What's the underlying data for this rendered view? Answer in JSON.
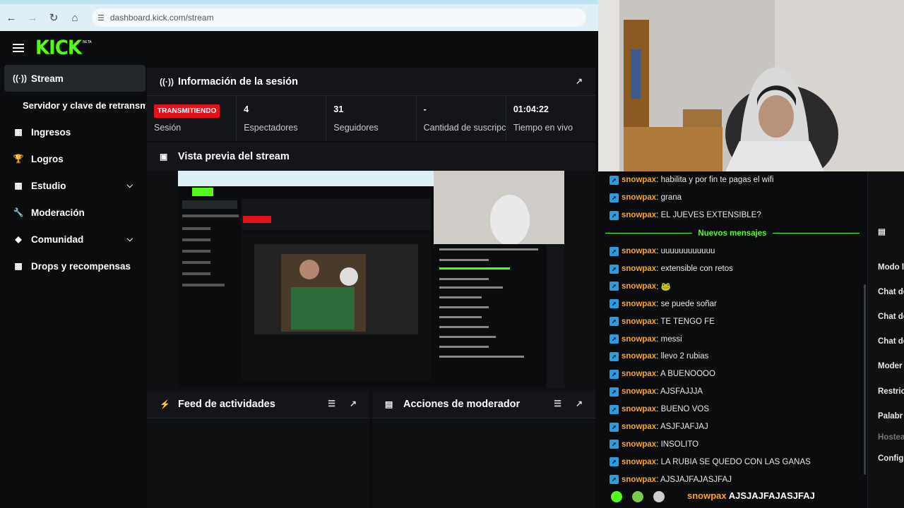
{
  "browser": {
    "url": "dashboard.kick.com/stream"
  },
  "brand": {
    "logo": "KICK",
    "beta": "BETA"
  },
  "sidebar": {
    "items": [
      {
        "label": "Stream",
        "icon": "broadcast-icon"
      },
      {
        "label": "Servidor y clave de retransmisión"
      },
      {
        "label": "Ingresos",
        "icon": "revenue-icon"
      },
      {
        "label": "Logros",
        "icon": "trophy-icon"
      },
      {
        "label": "Estudio",
        "icon": "studio-icon"
      },
      {
        "label": "Moderación",
        "icon": "wrench-icon"
      },
      {
        "label": "Comunidad",
        "icon": "community-icon"
      },
      {
        "label": "Drops y recompensas",
        "icon": "gift-icon"
      }
    ]
  },
  "session": {
    "title": "Información de la sesión",
    "status": "TRANSMITIENDO",
    "status_label": "Sesión",
    "viewers": "4",
    "viewers_label": "Espectadores",
    "followers": "31",
    "followers_label": "Seguidores",
    "subs": "-",
    "subs_label": "Cantidad de suscripciones",
    "uptime": "01:04:22",
    "uptime_label": "Tiempo en vivo"
  },
  "preview": {
    "title": "Vista previa del stream"
  },
  "feed": {
    "title": "Feed de actividades"
  },
  "mod": {
    "title": "Acciones de moderador"
  },
  "chat": {
    "messages_before": [
      {
        "user": "snowpax",
        "text": ": habilita y por fin te pagas el wifi"
      },
      {
        "user": "snowpax",
        "text": ": grana"
      },
      {
        "user": "snowpax",
        "text": ": EL JUEVES EXTENSIBLE?"
      }
    ],
    "new_label": "Nuevos mensajes",
    "messages_after": [
      {
        "user": "snowpax",
        "text": ": uuuuuuuuuuuu"
      },
      {
        "user": "snowpax",
        "text": ": extensible con retos"
      },
      {
        "user": "snowpax",
        "text": ": 🐸"
      },
      {
        "user": "snowpax",
        "text": ": se puede soñar"
      },
      {
        "user": "snowpax",
        "text": ": TE TENGO FE"
      },
      {
        "user": "snowpax",
        "text": ": messi"
      },
      {
        "user": "snowpax",
        "text": ": llevo 2 rubias"
      },
      {
        "user": "snowpax",
        "text": ": A BUENOOOO"
      },
      {
        "user": "snowpax",
        "text": ": AJSFAJJJA"
      },
      {
        "user": "snowpax",
        "text": ": BUENO VOS"
      },
      {
        "user": "snowpax",
        "text": ": ASJFJAFJAJ"
      },
      {
        "user": "snowpax",
        "text": ": INSOLITO"
      },
      {
        "user": "snowpax",
        "text": ": LA RUBIA SE QUEDO CON LAS GANAS"
      },
      {
        "user": "snowpax",
        "text": ": AJSJAJFAJASJFAJ"
      }
    ],
    "overlay_user": "snowpax",
    "overlay_text": " AJSJAJFAJASJFAJ"
  },
  "right_panel": {
    "items": [
      "Modo l",
      "Chat de",
      "Chat de",
      "Chat de",
      "Moder",
      "Restric",
      "Palabr",
      "Hostea",
      "Config"
    ]
  },
  "colors": {
    "accent": "#53fc18",
    "live": "#e1121c",
    "username": "#f5a623",
    "badge": "#2d9be0"
  }
}
